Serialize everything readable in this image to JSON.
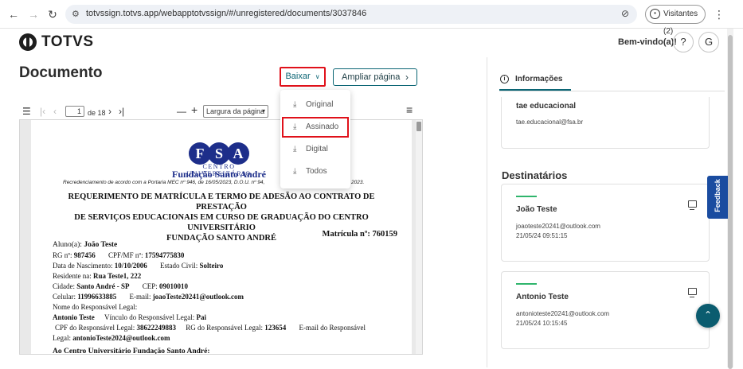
{
  "browser": {
    "url": "totvssign.totvs.app/webapptotvssign/#/unregistered/documents/3037846",
    "visitors_label": "Visitantes (2)"
  },
  "header": {
    "logo_text": "TOTVS",
    "welcome": "Bem-vindo(a)!",
    "help_symbol": "?",
    "logout_symbol": "G"
  },
  "document": {
    "title": "Documento",
    "download_label": "Baixar",
    "expand_label": "Ampliar página",
    "download_menu": [
      {
        "label": "Original"
      },
      {
        "label": "Assinado"
      },
      {
        "label": "Digital"
      },
      {
        "label": "Todos"
      }
    ]
  },
  "pdf_toolbar": {
    "page_current": "1",
    "page_total": "de 18",
    "zoom_minus": "—",
    "zoom_plus": "+",
    "zoom_option": "Largura da página"
  },
  "pdf_content": {
    "fsa_letters": [
      "F",
      "S",
      "A"
    ],
    "institution_line1": "CENTRO UNIVERSITÁRIO",
    "institution_line2": "Fundação Santo André",
    "recred": "Recredenciamento de acordo com a Portaria MEC nº 946, de 16/05/2023, D.O.U. nº 94, ",
    "recred_tail": "2023.",
    "title_l1": "REQUERIMENTO DE MATRÍCULA E TERMO DE ADESÃO AO CONTRATO DE PRESTAÇÃO",
    "title_l2": "DE SERVIÇOS EDUCACIONAIS EM CURSO DE GRADUAÇÃO DO CENTRO UNIVERSITÁRIO",
    "title_l3": "FUNDAÇÃO SANTO ANDRÉ",
    "matricula": "Matrícula nº: 760159",
    "aluno_label": "Aluno(a): ",
    "aluno_value": "João Teste",
    "rg_label": "RG nº: ",
    "rg_value": "987456",
    "cpf_label": "CPF/MF nº: ",
    "cpf_value": "17594775830",
    "nasc_label": "Data de Nascimento: ",
    "nasc_value": "10/10/2006",
    "civil_label": "Estado Civil: ",
    "civil_value": "Solteiro",
    "resid_label": "Residente na: ",
    "resid_value": "Rua Teste1, 222",
    "cidade_label": "Cidade: ",
    "cidade_value": "Santo André - SP",
    "cep_label": "CEP: ",
    "cep_value": "09010010",
    "cel_label": "Celular: ",
    "cel_value": "11996633885",
    "email_label": "E-mail: ",
    "email_value": "joaoTeste20241@outlook.com",
    "resp_label": "Nome do Responsável Legal:",
    "resp_value": "Antonio Teste",
    "vinculo_label": "Vínculo do Responsável Legal: ",
    "vinculo_value": "Pai",
    "cpf_resp_label": "CPF do Responsável Legal: ",
    "cpf_resp_value": "38622249883",
    "rg_resp_label": "RG do Responsável Legal: ",
    "rg_resp_value": "123654",
    "email_resp_label": "E-mail do Responsável",
    "legal_label": "Legal: ",
    "legal_value": "antonioTeste2024@outlook.com",
    "closing": "Ao Centro Universitário Fundação Santo André:"
  },
  "right_panel": {
    "tab_label": "Informações",
    "owner_name": "tae educacional",
    "owner_email": "tae.educacional@fsa.br",
    "recipients_title": "Destinatários",
    "recipients": [
      {
        "name": "João Teste",
        "email": "joaoteste20241@outlook.com",
        "date": "21/05/24 09:51:15"
      },
      {
        "name": "Antonio Teste",
        "email": "antonioteste20241@outlook.com",
        "date": "21/05/24 10:15:45"
      }
    ],
    "feedback_label": "Feedback"
  }
}
